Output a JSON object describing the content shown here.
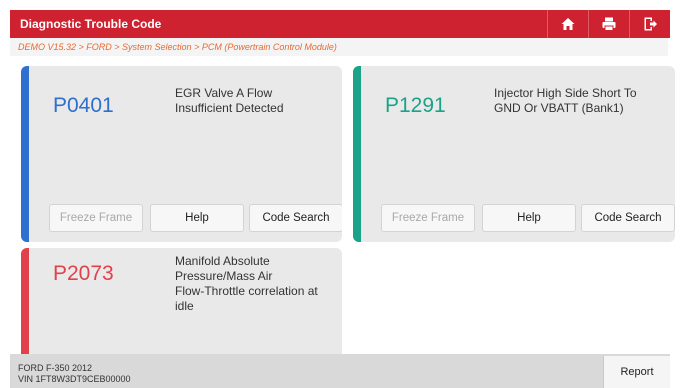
{
  "header": {
    "title": "Diagnostic Trouble Code",
    "icons": [
      "home-icon",
      "print-icon",
      "exit-icon"
    ],
    "accent": "#cf2230"
  },
  "breadcrumb": "DEMO V15.32 > FORD > System Selection > PCM (Powertrain Control Module)",
  "cards": [
    {
      "code": "P0401",
      "desc_lines": [
        "EGR Valve A Flow",
        "Insufficient Detected"
      ],
      "stripe_color": "#2f6fce",
      "code_color": "#2f6fce",
      "buttons": [
        "Freeze Frame",
        "Help",
        "Code Search"
      ]
    },
    {
      "code": "P1291",
      "desc_lines": [
        "Injector High Side Short To",
        "GND Or VBATT (Bank1)"
      ],
      "stripe_color": "#1aa389",
      "code_color": "#1aa389",
      "buttons": [
        "Freeze Frame",
        "Help",
        "Code Search"
      ]
    },
    {
      "code": "P2073",
      "desc_lines": [
        "Manifold Absolute",
        "Pressure/Mass Air",
        "Flow-Throttle correlation at",
        "idle"
      ],
      "stripe_color": "#e2404b",
      "code_color": "#e2404b"
    }
  ],
  "footer": {
    "vehicle_model": "FORD F-350 2012",
    "vin": "VIN 1FT8W3DT9CEB00000",
    "report_label": "Report"
  }
}
